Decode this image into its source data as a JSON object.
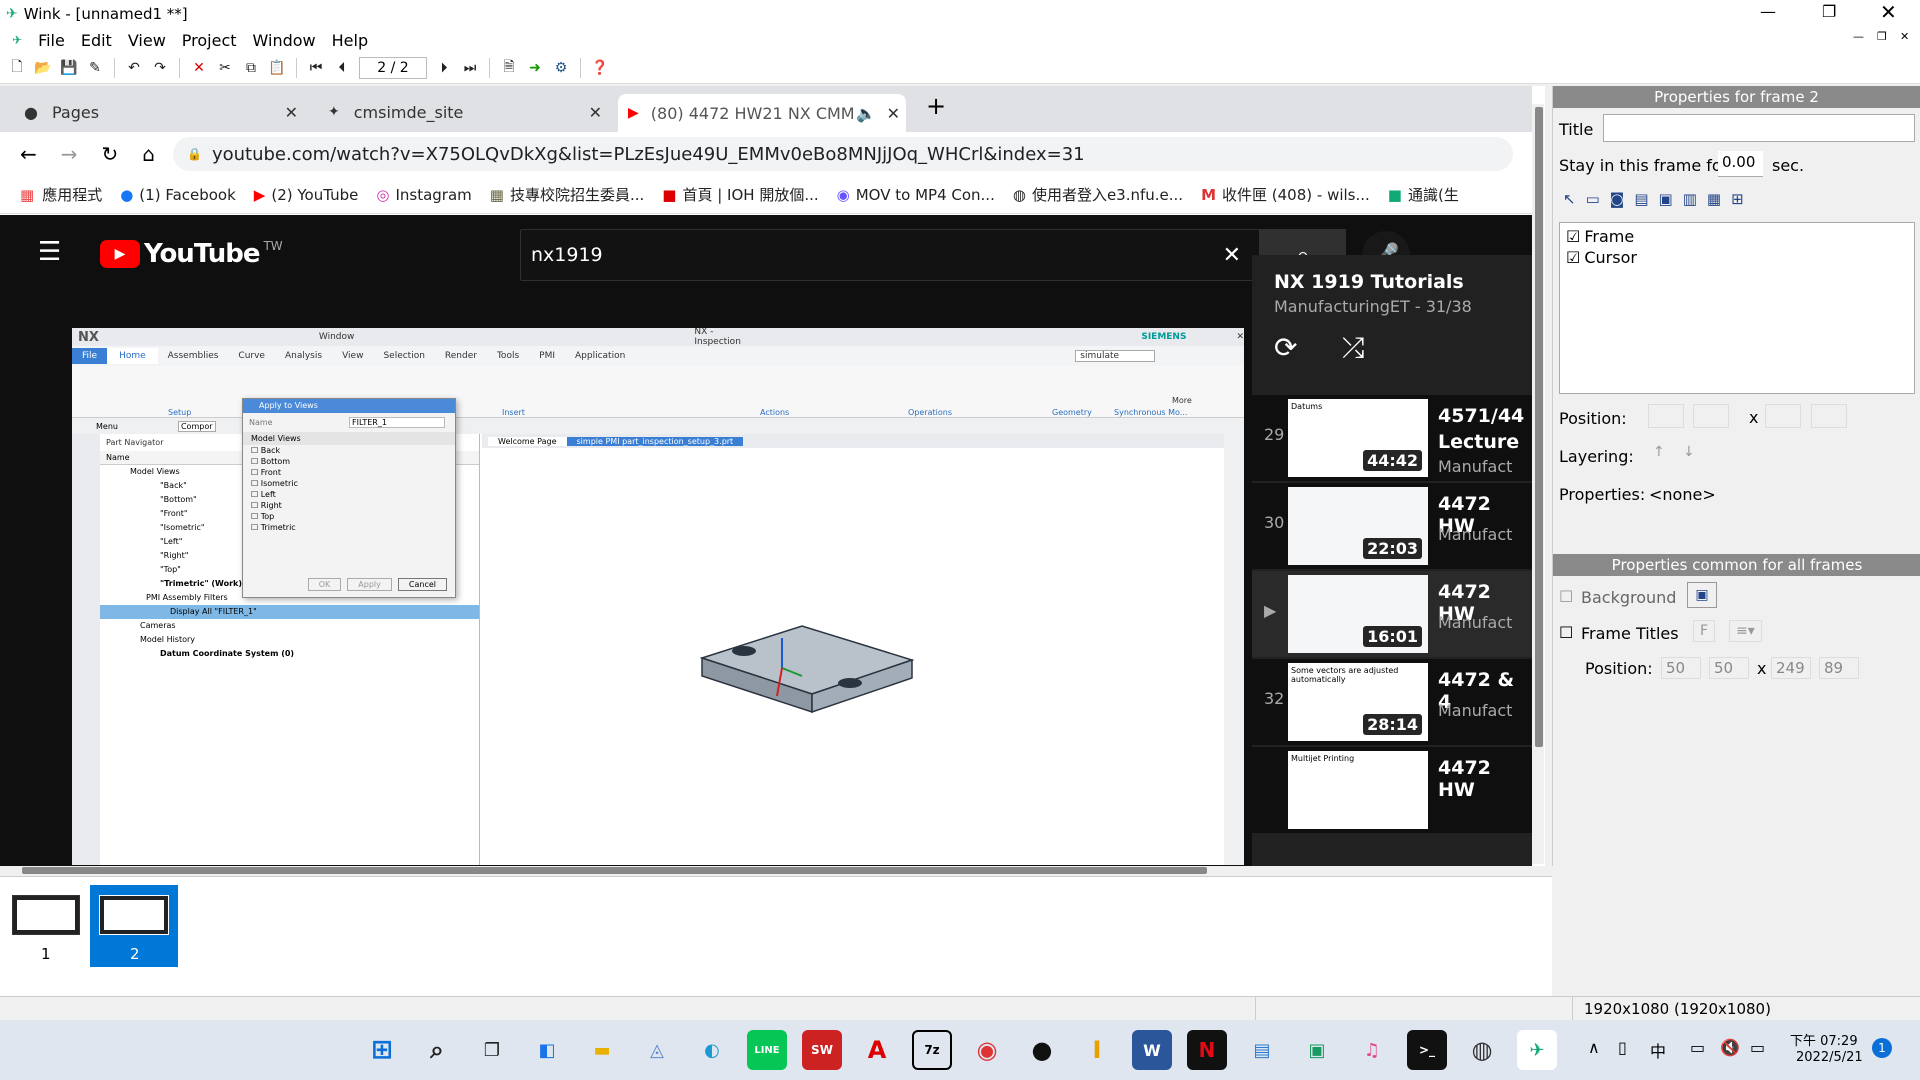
{
  "window": {
    "title": "Wink - [unnamed1 **]"
  },
  "menu": [
    "File",
    "Edit",
    "View",
    "Project",
    "Window",
    "Help"
  ],
  "toolbar": {
    "frame_counter": "2 / 2"
  },
  "browser": {
    "tabs": [
      {
        "label": "Pages"
      },
      {
        "label": "cmsimde_site"
      },
      {
        "label": "(80) 4472 HW21 NX CMM"
      }
    ],
    "url": "youtube.com/watch?v=X75OLQvDkXg&list=PLzEsJue49U_EMMv0eBo8MNJjJOq_WHCrl&index=31",
    "bookmarks": [
      "應用程式",
      "(1) Facebook",
      "(2) YouTube",
      "Instagram",
      "技專校院招生委員...",
      "首頁 | IOH 開放個...",
      "MOV to MP4 Con...",
      "使用者登入e3.nfu.e...",
      "收件匣 (408) - wils...",
      "通識(生"
    ]
  },
  "youtube": {
    "logo": "YouTube",
    "region": "TW",
    "search": "nx1919",
    "playlist_title": "NX 1919 Tutorials",
    "playlist_sub": "ManufacturingET - 31/38",
    "items": [
      {
        "index": "29",
        "title": "4571/44",
        "title2": "Lecture",
        "channel": "Manufact",
        "duration": "44:42",
        "thumb_text": "Datums"
      },
      {
        "index": "30",
        "title": "4472 HW",
        "channel": "Manufact",
        "duration": "22:03",
        "thumb_text": ""
      },
      {
        "index": "▶",
        "title": "4472 HW",
        "channel": "Manufact",
        "duration": "16:01",
        "thumb_text": ""
      },
      {
        "index": "32",
        "title": "4472 & 4",
        "channel": "Manufact",
        "duration": "28:14",
        "thumb_text": "Some vectors are adjusted automatically"
      },
      {
        "index": "",
        "title": "4472 HW",
        "channel": "",
        "duration": "",
        "thumb_text": "Multijet Printing"
      }
    ]
  },
  "nx": {
    "logo": "NX",
    "window_label": "Window",
    "app_title": "NX - Inspection",
    "brand": "SIEMENS",
    "tabs": [
      "File",
      "Home",
      "Assemblies",
      "Curve",
      "Analysis",
      "View",
      "Selection",
      "Render",
      "Tools",
      "PMI",
      "Application"
    ],
    "search": "simulate",
    "groups": [
      "Setup",
      "Insert",
      "Actions",
      "Operations",
      "Geometry",
      "Synchronous Mo..."
    ],
    "menu_label": "Menu",
    "compo": "Compor",
    "navigator": "Part Navigator",
    "nav_col": "Name",
    "tree": [
      "Model Views",
      "\"Back\"",
      "\"Bottom\"",
      "\"Front\"",
      "\"Isometric\"",
      "\"Left\"",
      "\"Right\"",
      "\"Top\"",
      "\"Trimetric\" (Work)",
      "PMI Assembly Filters",
      "Display All \"FILTER_1\"",
      "Cameras",
      "Model History",
      "Datum Coordinate System (0)"
    ],
    "dialog": {
      "title": "Apply to Views",
      "name_label": "Name",
      "name_value": "FILTER_1",
      "list_header": "Model Views",
      "views": [
        "Back",
        "Bottom",
        "Front",
        "Isometric",
        "Left",
        "Right",
        "Top",
        "Trimetric"
      ],
      "ok": "OK",
      "apply": "Apply",
      "cancel": "Cancel"
    },
    "doc_tabs": [
      "Welcome Page",
      "simple PMI part_inspection_setup_3.prt"
    ],
    "more": "More"
  },
  "props": {
    "frame_header": "Properties for frame 2",
    "title_label": "Title",
    "title_value": "",
    "stay_label": "Stay in this frame for",
    "stay_value": "0.00",
    "stay_unit": "sec.",
    "layers": [
      "Frame",
      "Cursor"
    ],
    "position_label": "Position:",
    "x_sep": "x",
    "layering_label": "Layering:",
    "properties_label": "Properties:",
    "properties_value": "<none>",
    "common_header": "Properties common for all frames",
    "background_label": "Background",
    "frame_titles_label": "Frame Titles",
    "common_position_label": "Position:",
    "common_pos": [
      "50",
      "50",
      "249",
      "89"
    ]
  },
  "filmstrip": {
    "frames": [
      "1",
      "2"
    ]
  },
  "status": {
    "resolution": "1920x1080 (1920x1080)"
  },
  "taskbar": {
    "ime": "中",
    "time": "下午 07:29",
    "date": "2022/5/21",
    "notif": "1"
  }
}
